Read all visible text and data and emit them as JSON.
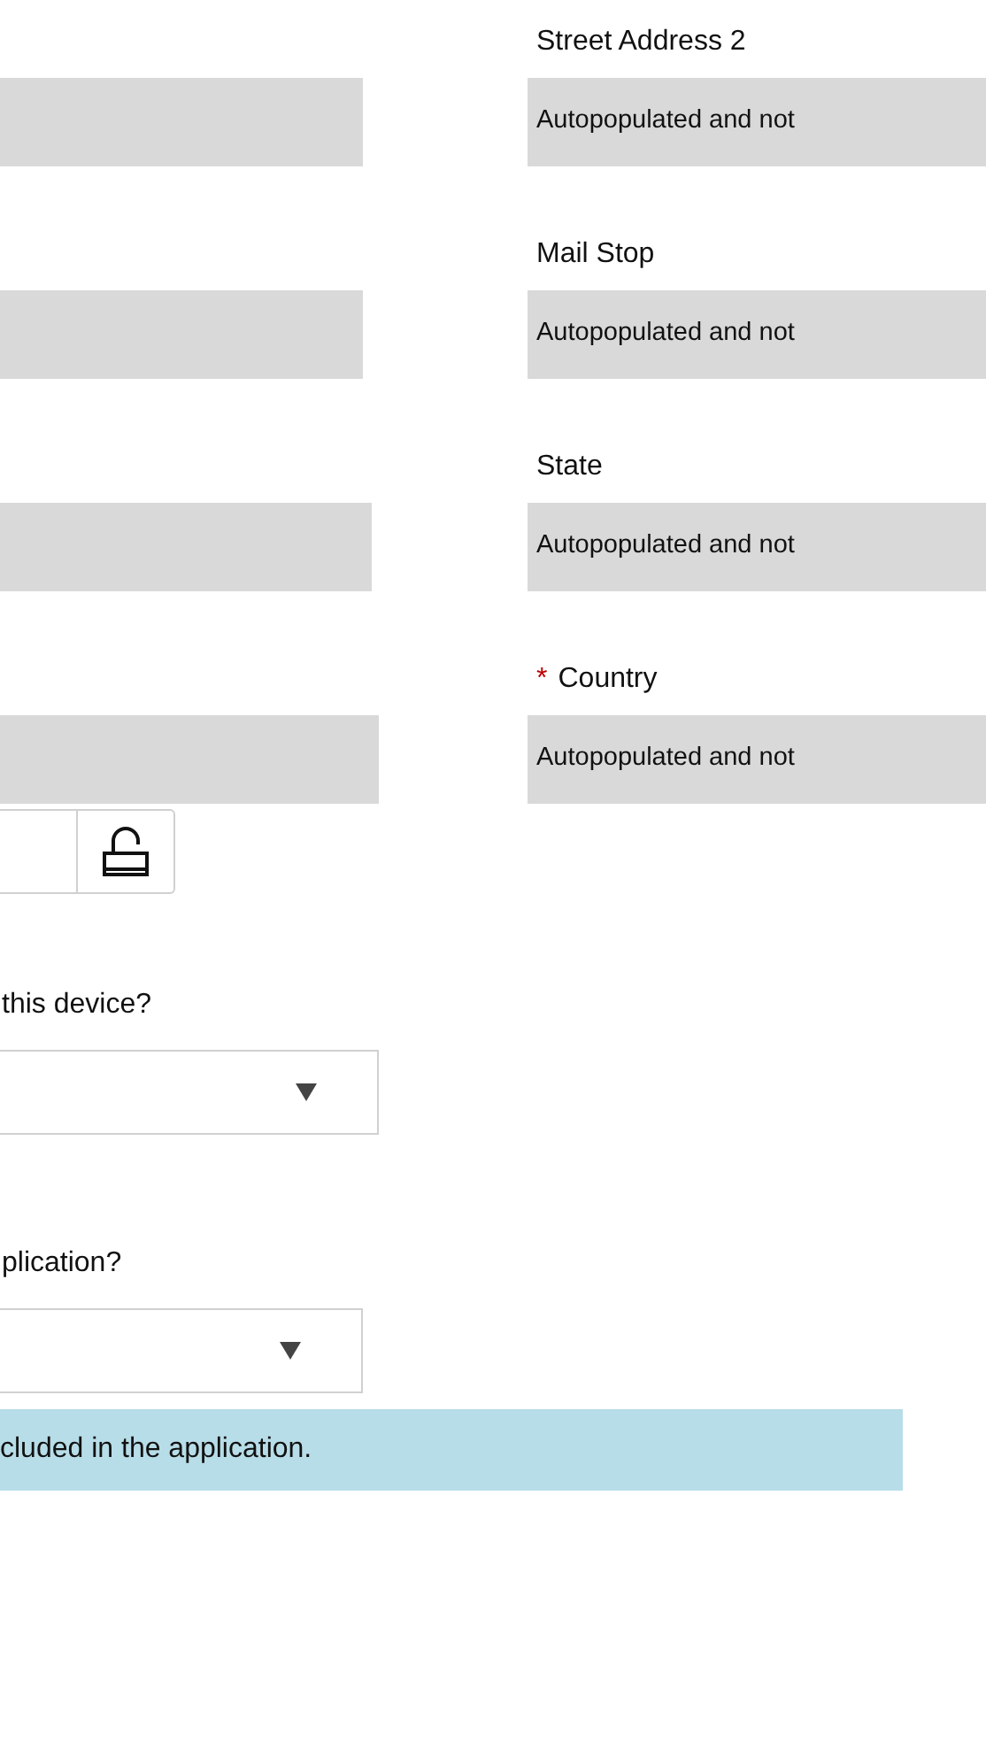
{
  "required_marker": "*",
  "left_fields": [
    {
      "readonly": true
    },
    {
      "readonly": true
    },
    {
      "readonly": true
    },
    {
      "readonly": true
    }
  ],
  "address_fields": [
    {
      "label": "Street Address 2",
      "required": false,
      "value": "Autopopulated and not"
    },
    {
      "label": "Mail Stop",
      "required": false,
      "value": "Autopopulated and not"
    },
    {
      "label": "State",
      "required": false,
      "value": "Autopopulated and not"
    },
    {
      "label": "Country",
      "required": true,
      "value": "Autopopulated and not"
    }
  ],
  "lock_field": {
    "locked": false
  },
  "questions": [
    {
      "label": "this device?"
    },
    {
      "label": "plication?"
    }
  ],
  "info_banner": {
    "text": "cluded in the application."
  }
}
